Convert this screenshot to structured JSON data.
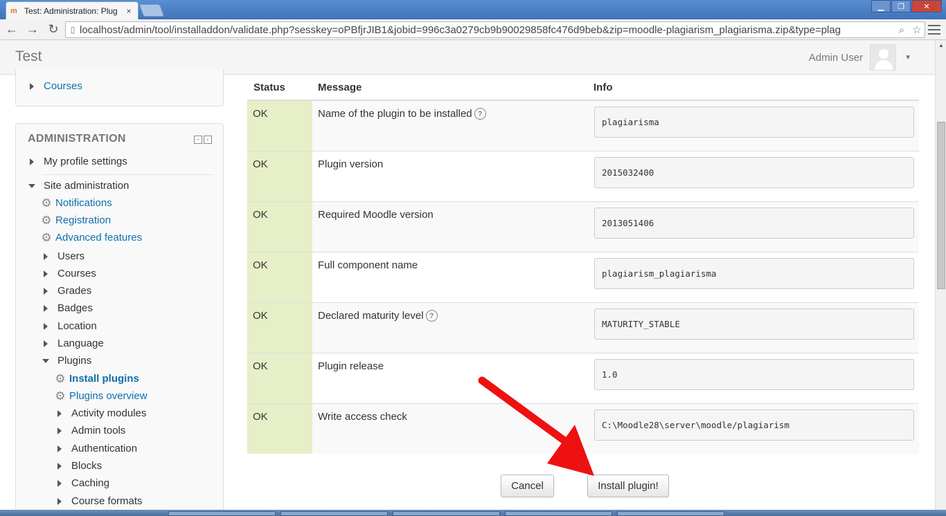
{
  "browser": {
    "tab_title": "Test: Administration: Plug",
    "tab_close": "×",
    "url": "localhost/admin/tool/installaddon/validate.php?sesskey=oPBfjrJIB1&jobid=996c3a0279cb9b90029858fc476d9beb&zip=moodle-plagiarism_plagiarisma.zip&type=plag"
  },
  "header": {
    "site_name": "Test",
    "user_name": "Admin User"
  },
  "nav": {
    "courses": "Courses",
    "admin_title": "ADMINISTRATION",
    "items": {
      "profile": "My profile settings",
      "site_admin": "Site administration",
      "notifications": "Notifications",
      "registration": "Registration",
      "advanced": "Advanced features",
      "users": "Users",
      "courses": "Courses",
      "grades": "Grades",
      "badges": "Badges",
      "location": "Location",
      "language": "Language",
      "plugins": "Plugins",
      "install_plugins": "Install plugins",
      "plugins_overview": "Plugins overview",
      "activity_modules": "Activity modules",
      "admin_tools": "Admin tools",
      "authentication": "Authentication",
      "blocks": "Blocks",
      "caching": "Caching",
      "course_formats": "Course formats"
    }
  },
  "table": {
    "headers": {
      "status": "Status",
      "message": "Message",
      "info": "Info"
    },
    "rows": [
      {
        "status": "OK",
        "message": "Name of the plugin to be installed",
        "info": "plagiarisma",
        "help": true
      },
      {
        "status": "OK",
        "message": "Plugin version",
        "info": "2015032400",
        "help": false
      },
      {
        "status": "OK",
        "message": "Required Moodle version",
        "info": "2013051406",
        "help": false
      },
      {
        "status": "OK",
        "message": "Full component name",
        "info": "plagiarism_plagiarisma",
        "help": false
      },
      {
        "status": "OK",
        "message": "Declared maturity level",
        "info": "MATURITY_STABLE",
        "help": true
      },
      {
        "status": "OK",
        "message": "Plugin release",
        "info": "1.0",
        "help": false
      },
      {
        "status": "OK",
        "message": "Write access check",
        "info": "C:\\Moodle28\\server\\moodle/plagiarism",
        "help": false
      }
    ]
  },
  "actions": {
    "cancel": "Cancel",
    "install": "Install plugin!"
  },
  "colors": {
    "status_ok_bg": "#e6efc8",
    "link": "#0f6fad",
    "annotation_arrow": "#ee1111"
  }
}
